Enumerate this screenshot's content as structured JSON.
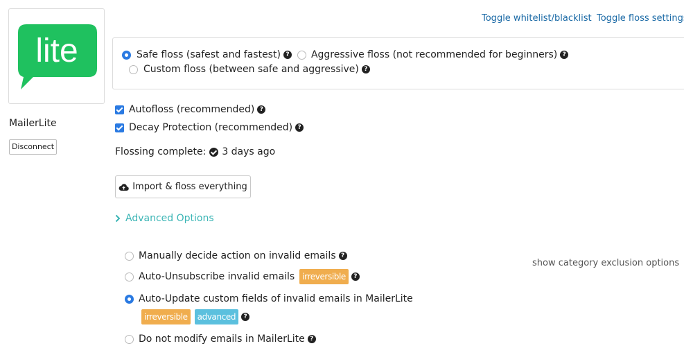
{
  "integration": {
    "logo_text": "lite",
    "name": "MailerLite",
    "disconnect_label": "Disconnect"
  },
  "header_links": {
    "whitelist": "Toggle whitelist/blacklist",
    "floss_settings": "Toggle floss settings"
  },
  "floss_modes": {
    "safe": "Safe floss (safest and fastest)",
    "aggressive": "Aggressive floss (not recommended for beginners)",
    "custom": "Custom floss (between safe and aggressive)",
    "selected": "safe"
  },
  "options": {
    "autofloss": "Autofloss (recommended)",
    "decay": "Decay Protection (recommended)"
  },
  "status": {
    "label": "Flossing complete:",
    "time": "3 days ago"
  },
  "import_button": "Import & floss everything",
  "advanced": {
    "toggle_label": "Advanced Options",
    "category_link": "show category exclusion options",
    "invalid_actions": {
      "manual": "Manually decide action on invalid emails",
      "unsubscribe": "Auto-Unsubscribe invalid emails",
      "update": "Auto-Update custom fields of invalid emails in MailerLite",
      "none": "Do not modify emails in MailerLite",
      "selected": "update"
    },
    "badges": {
      "irreversible": "irreversible",
      "advanced": "advanced"
    }
  },
  "colors": {
    "brand_green": "#1fc15f",
    "accent_blue": "#2a7ae2",
    "link_blue": "#1b6aa6",
    "teal": "#3bb5b5",
    "badge_orange": "#f0ad4e",
    "badge_teal": "#5bc0de"
  },
  "icons": {
    "help": "question-circle-icon",
    "complete": "check-circle-icon",
    "import": "cloud-upload-icon",
    "advanced": "chevron-right-icon"
  }
}
